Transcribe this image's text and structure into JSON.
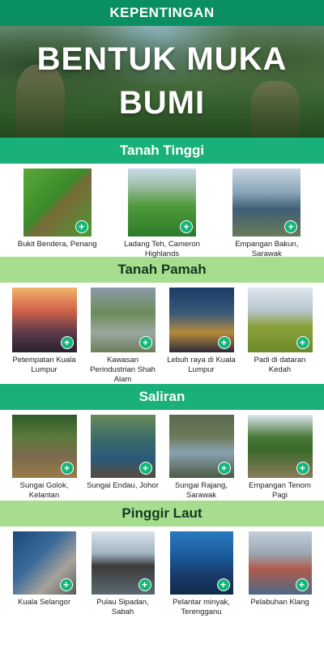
{
  "header": {
    "banner": "KEPENTINGAN",
    "title_line1": "BENTUK MUKA",
    "title_line2": "BUMI"
  },
  "sections": [
    {
      "title": "Tanah Tinggi",
      "items": [
        {
          "caption": "Bukit Bendera, Penang"
        },
        {
          "caption": "Ladang Teh, Cameron Highlands"
        },
        {
          "caption": "Empangan Bakun, Sarawak"
        }
      ]
    },
    {
      "title": "Tanah Pamah",
      "items": [
        {
          "caption": "Petempatan Kuala Lumpur"
        },
        {
          "caption": "Kawasan Perindustrian Shah Alam"
        },
        {
          "caption": "Lebuh raya di Kuala Lumpur"
        },
        {
          "caption": "Padi di dataran Kedah"
        }
      ]
    },
    {
      "title": "Saliran",
      "items": [
        {
          "caption": "Sungai Golok, Kelantan"
        },
        {
          "caption": "Sungai Endau, Johor"
        },
        {
          "caption": "Sungai Rajang, Sarawak"
        },
        {
          "caption": "Empangan Tenom Pagi"
        }
      ]
    },
    {
      "title": "Pinggir Laut",
      "items": [
        {
          "caption": "Kuala Selangor"
        },
        {
          "caption": "Pulau Sipadan, Sabah"
        },
        {
          "caption": "Pelantar minyak, Terengganu"
        },
        {
          "caption": "Pelabuhan Klang"
        }
      ]
    }
  ],
  "icons": {
    "expand": "+"
  },
  "colors": {
    "banner": "#0a8f62",
    "section_dark": "#19b07a",
    "section_light": "#a7dd8f",
    "plus": "#13b77a"
  }
}
